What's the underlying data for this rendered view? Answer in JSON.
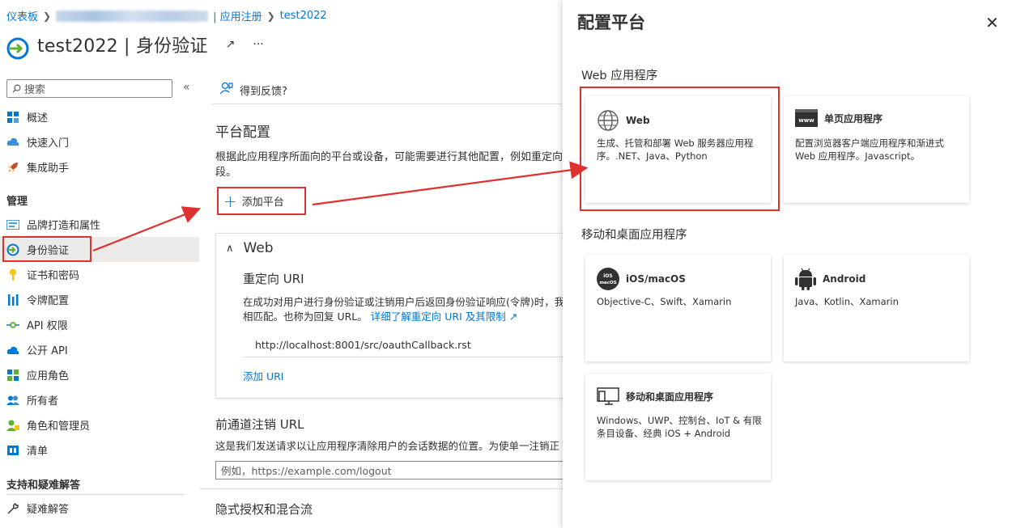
{
  "breadcrumb": {
    "home": "仪表板",
    "middle_suffix": "| 应用注册",
    "current": "test2022"
  },
  "header": {
    "title": "test2022 | 身份验证"
  },
  "sidebar": {
    "search_placeholder": "搜索",
    "items": [
      {
        "label": "概述"
      },
      {
        "label": "快速入门"
      },
      {
        "label": "集成助手"
      }
    ],
    "manage_title": "管理",
    "manage_items": [
      {
        "label": "品牌打造和属性"
      },
      {
        "label": "身份验证"
      },
      {
        "label": "证书和密码"
      },
      {
        "label": "令牌配置"
      },
      {
        "label": "API 权限"
      },
      {
        "label": "公开 API"
      },
      {
        "label": "应用角色"
      },
      {
        "label": "所有者"
      },
      {
        "label": "角色和管理员"
      },
      {
        "label": "清单"
      }
    ],
    "support_title": "支持和疑难解答",
    "support_items": [
      {
        "label": "疑难解答"
      }
    ]
  },
  "main": {
    "feedback": "得到反馈?",
    "platform_title": "平台配置",
    "platform_desc": "根据此应用程序所面向的平台或设备，可能需要进行其他配置，例如重定向段。",
    "add_platform": "添加平台",
    "web_card": {
      "title": "Web",
      "redirect_title": "重定向 URI",
      "redirect_desc": "在成功对用户进行身份验证或注销用户后返回身份验证响应(令牌)时，我相匹配。也称为回复 URL。",
      "learn_more": "详细了解重定向 URI 及其限制",
      "uri": "http://localhost:8001/src/oauthCallback.rst",
      "add_uri": "添加 URI"
    },
    "logout_title": "前通道注销 URL",
    "logout_desc": "这是我们发送请求以让应用程序清除用户的会话数据的位置。为使单一注销正",
    "logout_placeholder": "例如，https://example.com/logout",
    "implicit_title": "隐式授权和混合流"
  },
  "panel": {
    "title": "配置平台",
    "web_group": "Web 应用程序",
    "tiles_web": [
      {
        "name": "Web",
        "desc": "生成、托管和部署 Web 服务器应用程序。.NET、Java、Python"
      },
      {
        "name": "单页应用程序",
        "desc": "配置浏览器客户端应用程序和渐进式 Web 应用程序。Javascript。"
      }
    ],
    "mobile_group": "移动和桌面应用程序",
    "tiles_mobile": [
      {
        "name": "iOS/macOS",
        "desc": "Objective-C、Swift、Xamarin"
      },
      {
        "name": "Android",
        "desc": "Java、Kotlin、Xamarin"
      },
      {
        "name": "移动和桌面应用程序",
        "desc": "Windows、UWP、控制台、IoT & 有限条目设备、经典 iOS + Android"
      }
    ]
  },
  "colors": {
    "accent": "#0078d4",
    "annotation_red": "#e03131"
  }
}
